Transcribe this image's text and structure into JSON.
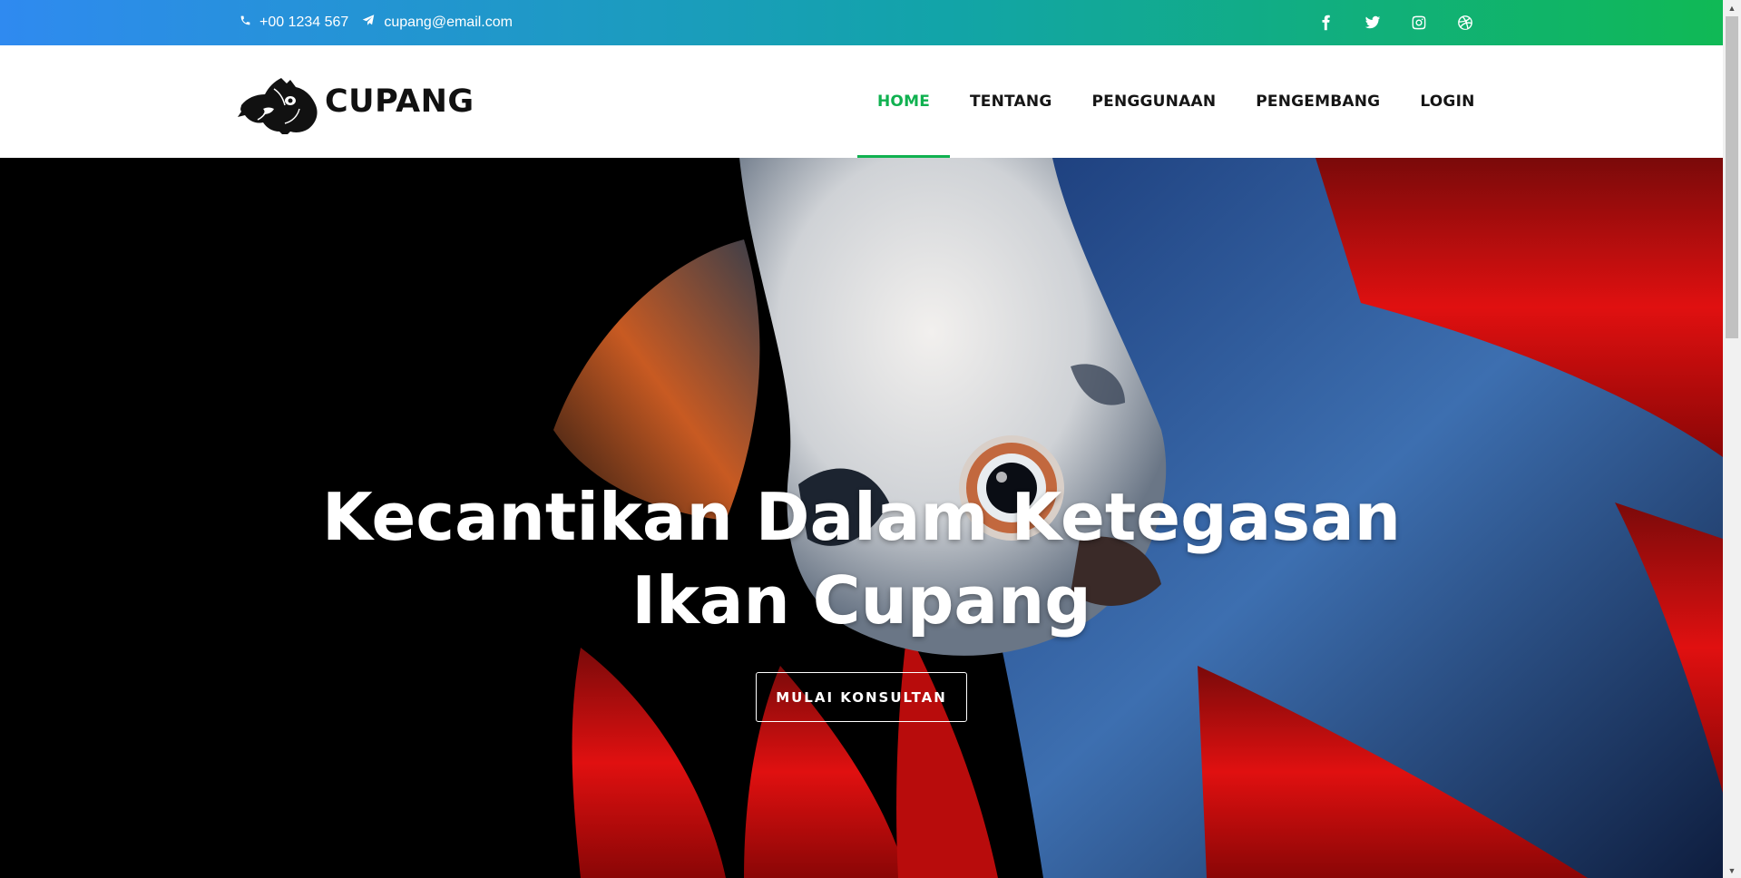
{
  "topbar": {
    "phone": "+00 1234 567",
    "email": "cupang@email.com",
    "phone_icon": "phone-icon",
    "email_icon": "paper-plane-icon",
    "social": [
      "facebook-icon",
      "twitter-icon",
      "instagram-icon",
      "dribbble-icon"
    ],
    "gradient": [
      "#2f8af0",
      "#10b955"
    ]
  },
  "header": {
    "brand": "CUPANG",
    "logo_icon": "betta-fish-logo",
    "nav": [
      {
        "label": "HOME",
        "active": true
      },
      {
        "label": "TENTANG",
        "active": false
      },
      {
        "label": "PENGGUNAAN",
        "active": false
      },
      {
        "label": "PENGEMBANG",
        "active": false
      },
      {
        "label": "LOGIN",
        "active": false
      }
    ],
    "accent": "#10b150"
  },
  "hero": {
    "title_line1": "Kecantikan Dalam Ketegasan",
    "title_line2": "Ikan Cupang",
    "button": "MULAI KONSULTAN"
  }
}
